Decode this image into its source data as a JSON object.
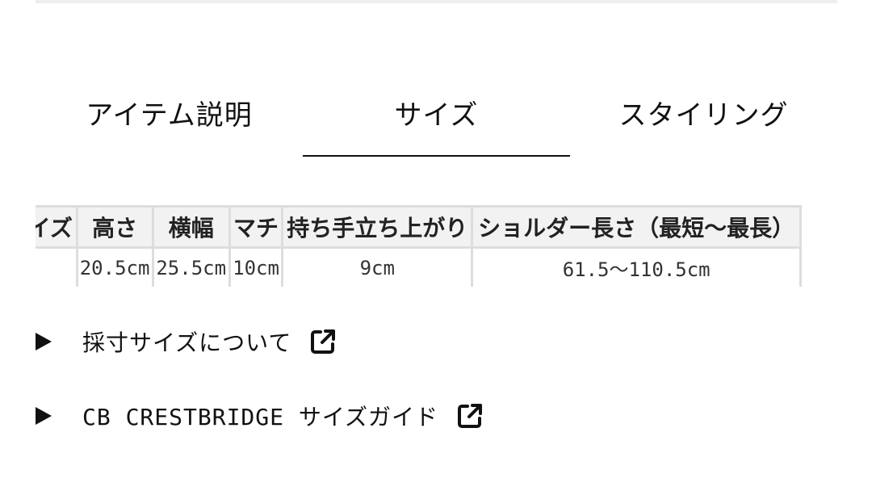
{
  "tabs": [
    {
      "label": "アイテム説明"
    },
    {
      "label": "サイズ"
    },
    {
      "label": "スタイリング"
    }
  ],
  "active_tab": "サイズ",
  "size_table": {
    "headers": [
      "サイズ",
      "高さ",
      "横幅",
      "マチ",
      "持ち手立ち上がり",
      "ショルダー長さ（最短〜最長）"
    ],
    "rows": [
      [
        "",
        "20.5cm",
        "25.5cm",
        "10cm",
        "9cm",
        "61.5〜110.5cm"
      ]
    ]
  },
  "links": [
    {
      "label": "採寸サイズについて",
      "icon": "external-link-icon"
    },
    {
      "label": "CB CRESTBRIDGE サイズガイド",
      "icon": "external-link-icon"
    }
  ],
  "colors": {
    "text": "#111111",
    "table_border": "#dddddd",
    "table_header_bg": "#f2f2f2"
  }
}
